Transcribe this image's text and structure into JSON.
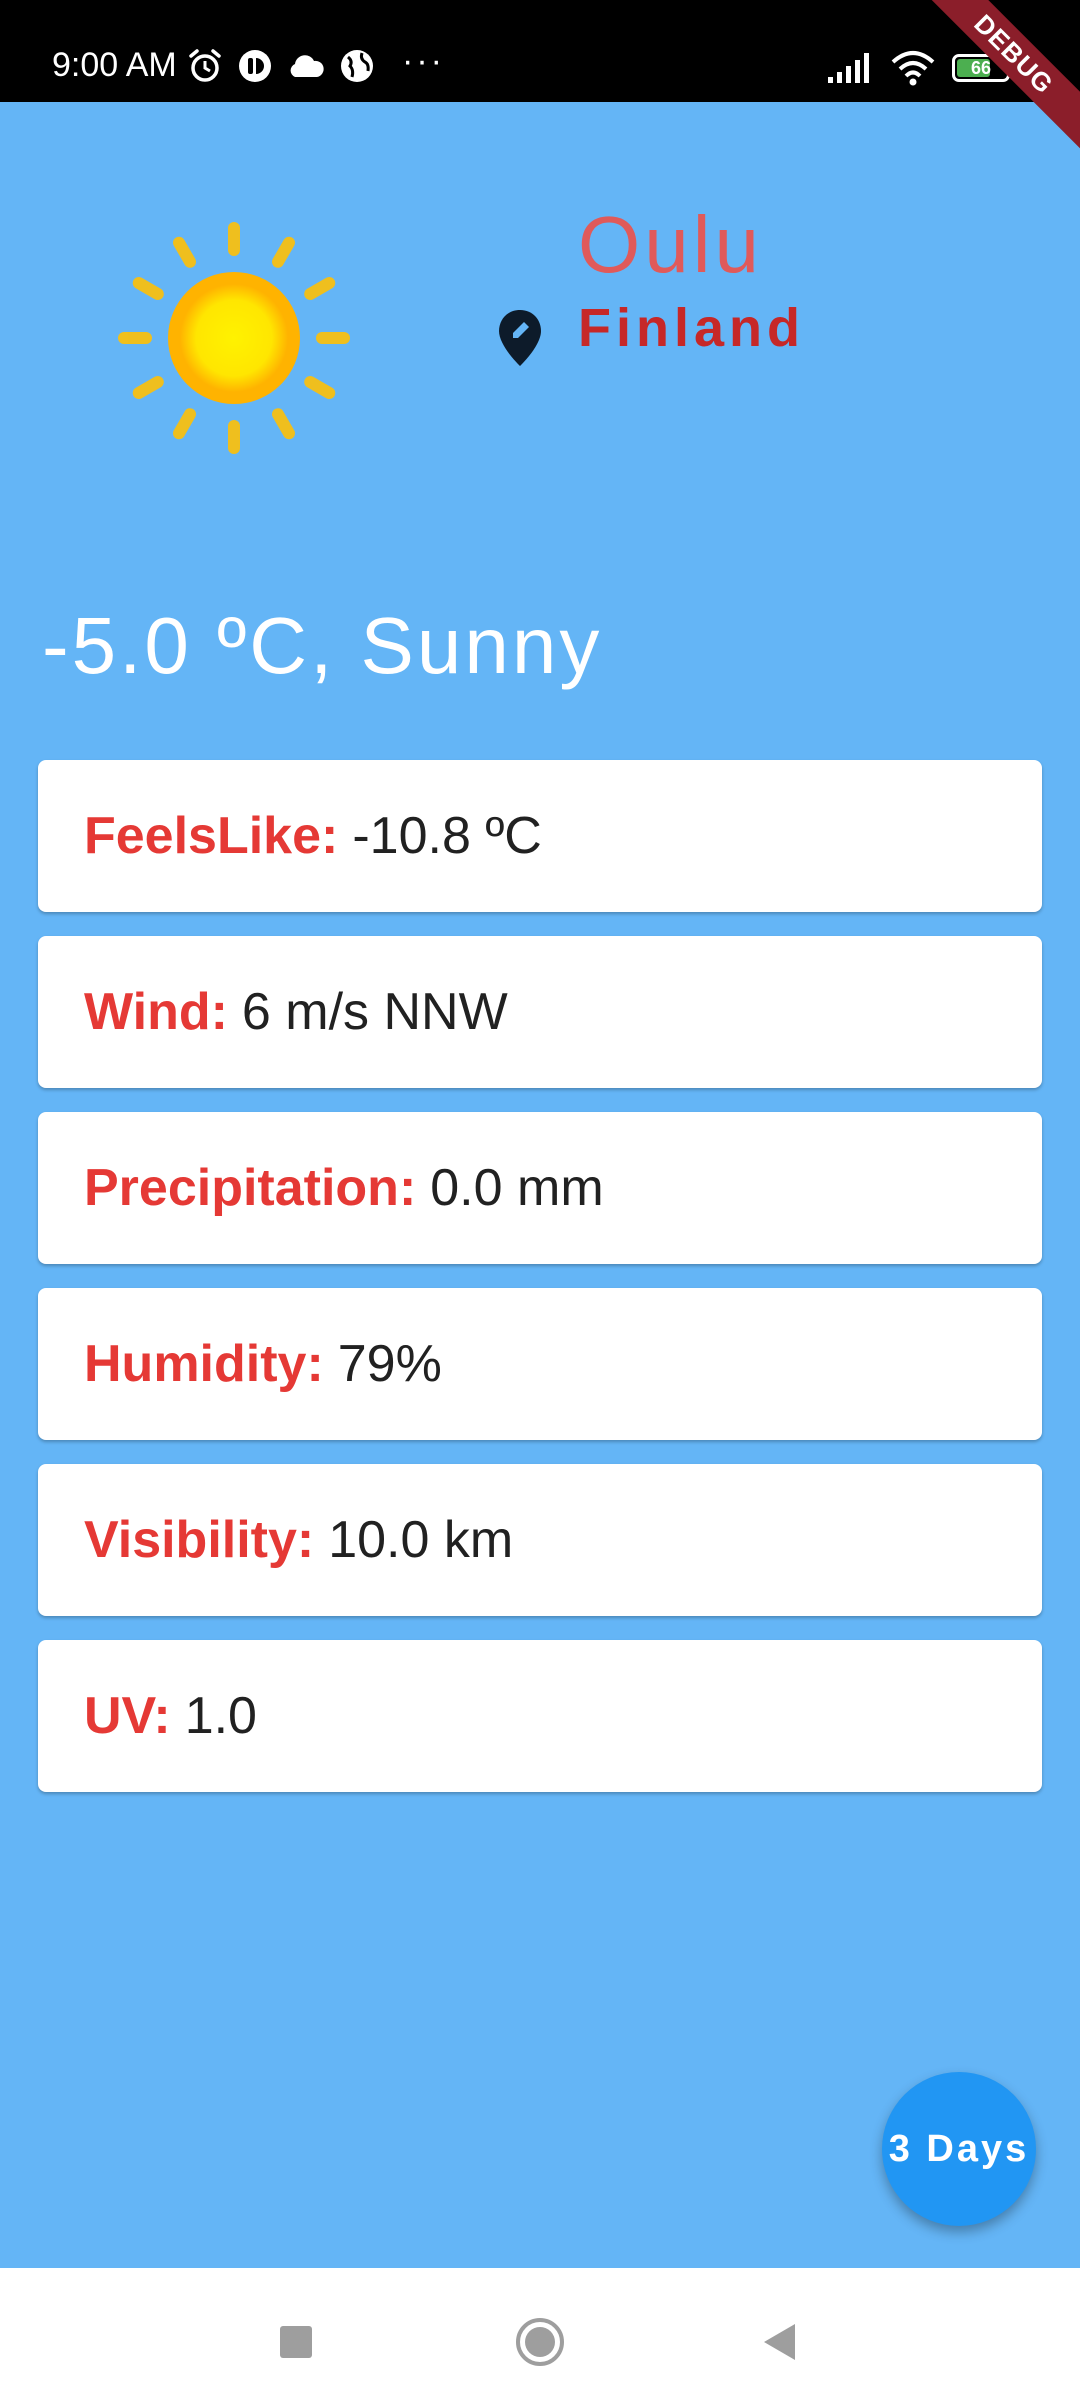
{
  "status_bar": {
    "time": "9:00 AM",
    "icons_left": [
      "alarm-icon",
      "app-notification-icon",
      "cloud-icon",
      "globe-icon"
    ],
    "more_indicator": "···",
    "battery_level": "66",
    "icons_right": [
      "signal-icon",
      "wifi-icon",
      "battery-icon"
    ]
  },
  "debug_banner": "DEBUG",
  "location": {
    "city": "Oulu",
    "country": "Finland",
    "icon": "location-edit-pin-icon"
  },
  "weather": {
    "icon": "sun-icon",
    "summary": "-5.0 ºC, Sunny"
  },
  "details": [
    {
      "label": "FeelsLike:",
      "value": "-10.8 ºC"
    },
    {
      "label": "Wind:",
      "value": "6 m/s NNW"
    },
    {
      "label": "Precipitation:",
      "value": "0.0 mm"
    },
    {
      "label": "Humidity:",
      "value": "79%"
    },
    {
      "label": "Visibility:",
      "value": "10.0 km"
    },
    {
      "label": "UV:",
      "value": "1.0"
    }
  ],
  "fab": {
    "label": "3 Days"
  },
  "colors": {
    "background": "#64B5F6",
    "city": "#E05A5A",
    "country": "#C62828",
    "label": "#E53935",
    "fab": "#2196F3",
    "debug_banner": "#8B1E2A"
  },
  "nav_bar": {
    "buttons": [
      "recents-icon",
      "home-icon",
      "back-icon"
    ]
  }
}
